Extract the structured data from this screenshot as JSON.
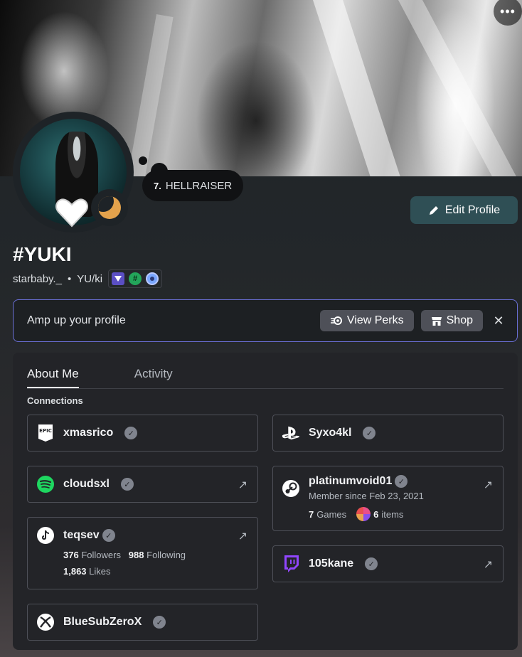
{
  "header": {
    "more_label": "•••"
  },
  "status": {
    "emoji": "7.",
    "text": "HELLRAISER"
  },
  "buttons": {
    "edit_profile": "Edit Profile"
  },
  "profile": {
    "display_name": "#YUKI",
    "username": "starbaby._",
    "separator": "•",
    "pronouns": "YU/ki"
  },
  "perks": {
    "text": "Amp up your profile",
    "view_perks": "View Perks",
    "shop": "Shop",
    "close": "✕"
  },
  "tabs": [
    {
      "label": "About Me",
      "active": true
    },
    {
      "label": "Activity",
      "active": false
    }
  ],
  "connections_label": "Connections",
  "connections": {
    "epic": {
      "name": "xmasrico"
    },
    "playstation": {
      "name": "Syxo4kl"
    },
    "spotify": {
      "name": "cloudsxl"
    },
    "steam": {
      "name": "platinumvoid01",
      "member_since": "Member since Feb 23, 2021",
      "games_count": "7",
      "games_label": "Games",
      "items_count": "6",
      "items_label": "items"
    },
    "tiktok": {
      "name": "teqsev",
      "followers": "376",
      "followers_label": "Followers",
      "following": "988",
      "following_label": "Following",
      "likes": "1,863",
      "likes_label": "Likes"
    },
    "twitch": {
      "name": "105kane"
    },
    "xbox": {
      "name": "BlueSubZeroX"
    }
  },
  "colors": {
    "accent_border": "#6a6fd6",
    "edit_button": "#2f4f55",
    "status_moon": "#e3a24c"
  }
}
